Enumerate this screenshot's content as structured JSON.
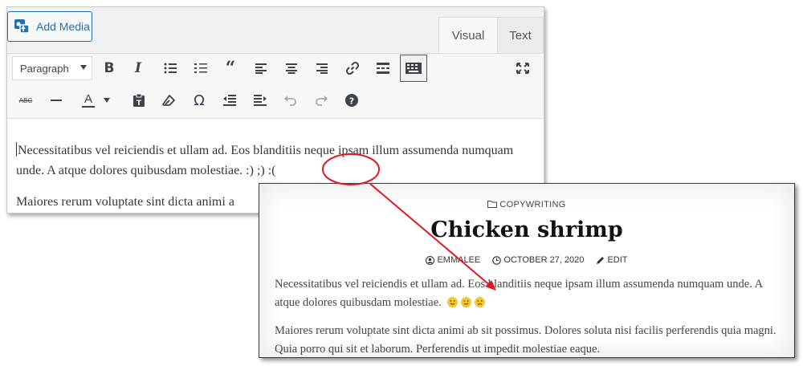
{
  "editor": {
    "add_media_label": "Add Media",
    "tabs": {
      "visual": "Visual",
      "text": "Text"
    },
    "format_select": "Paragraph",
    "toolbar_icons": [
      "bold-icon",
      "italic-icon",
      "bulleted-list-icon",
      "numbered-list-icon",
      "blockquote-icon",
      "align-left-icon",
      "align-center-icon",
      "align-right-icon",
      "link-icon",
      "read-more-icon",
      "toolbar-toggle-icon",
      "fullscreen-icon",
      "strikethrough-icon",
      "horizontal-line-icon",
      "text-color-icon",
      "paste-as-text-icon",
      "clear-formatting-icon",
      "special-character-icon",
      "outdent-icon",
      "indent-icon",
      "undo-icon",
      "redo-icon",
      "help-icon"
    ],
    "paragraph1": "Necessitatibus vel reiciendis et ullam ad. Eos blanditiis neque ipsam illum assumenda numquam unde. A atque dolores quibusdam molestiae. :) ;) :(",
    "paragraph2": "Maiores rerum voluptate sint dicta animi a"
  },
  "preview": {
    "category": "COPYWRITING",
    "title": "Chicken shrimp",
    "author": "EMMALEE",
    "date": "OCTOBER 27, 2020",
    "edit": "EDIT",
    "paragraph1": "Necessitatibus vel reiciendis et ullam ad. Eos blanditiis neque ipsam illum assumenda numquam unde. A atque dolores quibusdam molestiae.",
    "emojis": [
      "slightly-smiling-face",
      "winking-face",
      "slightly-frowning-face"
    ],
    "paragraph2": "Maiores rerum voluptate sint dicta animi ab sit possimus. Dolores soluta nisi facilis perferendis quia magni. Quia porro qui sit et laborum. Perferendis ut impedit molestiae eaque."
  },
  "annotation": {
    "color": "#e0191f"
  },
  "colors": {
    "accent": "#2271b1"
  }
}
